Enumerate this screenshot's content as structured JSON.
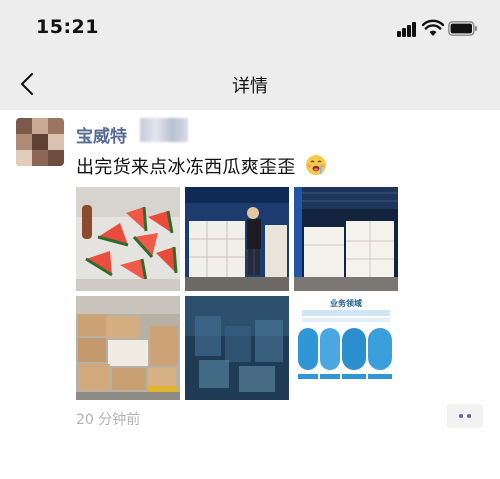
{
  "status_bar": {
    "time": "15:21"
  },
  "nav": {
    "title": "详情",
    "back_icon": "chevron-left-icon"
  },
  "post": {
    "username": "宝威特",
    "text": "出完货来点冰冻西瓜爽歪歪",
    "emoji": "drooling-face-icon",
    "images": [
      {
        "name": "watermelon-slices"
      },
      {
        "name": "warehouse-worker-boxes"
      },
      {
        "name": "container-cargo-boxes"
      },
      {
        "name": "packed-cartons-forklift"
      },
      {
        "name": "blurred-blue-image"
      },
      {
        "name": "business-field-infographic",
        "caption": "业务领域"
      }
    ],
    "time_ago": "20 分钟前",
    "more_icon": "comment-more-icon"
  },
  "colors": {
    "link": "#576b95",
    "bar": "#ededed",
    "muted": "#b2b2b2"
  }
}
